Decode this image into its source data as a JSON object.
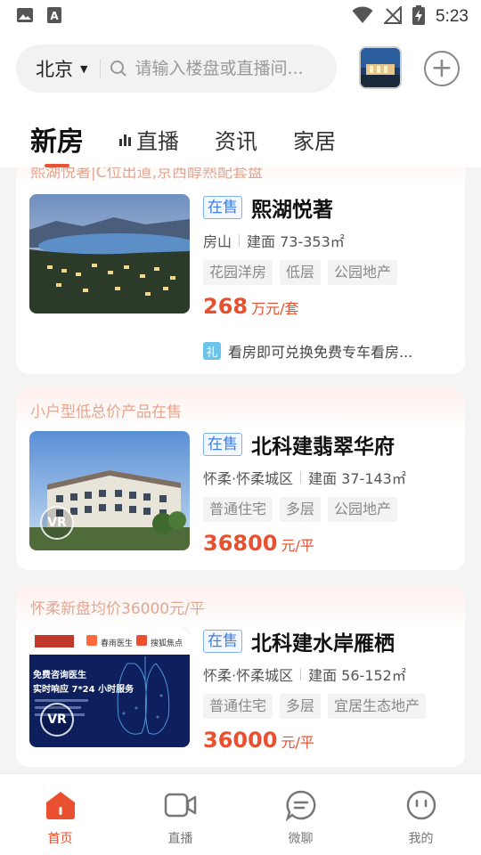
{
  "status_bar": {
    "time": "5:23",
    "icons": [
      "gallery-icon",
      "a-box-icon",
      "wifi-icon",
      "no-signal-icon",
      "battery-charging-icon"
    ]
  },
  "header": {
    "city": "北京",
    "search_placeholder": "请输入楼盘或直播间...",
    "tabs": [
      {
        "label": "新房",
        "active": true
      },
      {
        "label": "直播",
        "active": false
      },
      {
        "label": "资讯",
        "active": false
      },
      {
        "label": "家居",
        "active": false
      }
    ]
  },
  "listings": [
    {
      "tagline": "熙湖悦著|C位出道,京西醇熟配套盘",
      "status": "在售",
      "name": "熙湖悦著",
      "district": "房山",
      "area": "建面 73-353㎡",
      "tags": [
        "花园洋房",
        "低层",
        "公园地产"
      ],
      "price": "268",
      "price_unit": "万元/套",
      "promo": "看房即可兑换免费专车看房...",
      "promo_icon": "礼"
    },
    {
      "tagline": "小户型低总价产品在售",
      "status": "在售",
      "name": "北科建翡翠华府",
      "district": "怀柔·怀柔城区",
      "area": "建面 37-143㎡",
      "tags": [
        "普通住宅",
        "多层",
        "公园地产"
      ],
      "price": "36800",
      "price_unit": "元/平",
      "vr": "VR"
    },
    {
      "tagline": "怀柔新盘均价36000元/平",
      "status": "在售",
      "name": "北科建水岸雁栖",
      "district": "怀柔·怀柔城区",
      "area": "建面 56-152㎡",
      "tags": [
        "普通住宅",
        "多层",
        "宜居生态地产"
      ],
      "price": "36000",
      "price_unit": "元/平",
      "vr": "VR",
      "ad": {
        "line1": "免费咨询医生",
        "line2": "实时响应 7*24 小时服务",
        "brand1": "春雨医生",
        "brand2": "搜狐焦点"
      }
    }
  ],
  "bottom_nav": [
    {
      "label": "首页",
      "icon": "home-icon",
      "active": true
    },
    {
      "label": "直播",
      "icon": "video-icon",
      "active": false
    },
    {
      "label": "微聊",
      "icon": "chat-icon",
      "active": false
    },
    {
      "label": "我的",
      "icon": "profile-icon",
      "active": false
    }
  ],
  "colors": {
    "accent": "#e8502f",
    "badge_blue": "#3a7ee8",
    "tagline": "#e3a690"
  }
}
